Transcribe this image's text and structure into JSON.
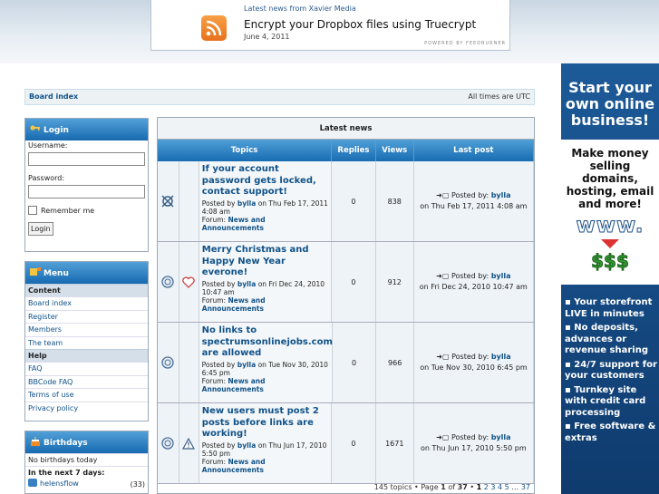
{
  "feed": {
    "source": "Latest news from Xavier Media",
    "headline": "Encrypt your Dropbox files using Truecrypt",
    "date": "June 4, 2011",
    "powered": "POWERED BY FEEDBURNER"
  },
  "breadcrumb": {
    "board_index": "Board index",
    "timezone": "All times are UTC"
  },
  "login": {
    "title": "Login",
    "username_label": "Username:",
    "password_label": "Password:",
    "remember_label": "Remember me",
    "button": "Login"
  },
  "menu": {
    "title": "Menu",
    "sections": [
      {
        "heading": "Content",
        "items": [
          "Board index",
          "Register",
          "Members",
          "The team"
        ]
      },
      {
        "heading": "Help",
        "items": [
          "FAQ",
          "BBCode FAQ",
          "Terms of use",
          "Privacy policy"
        ]
      }
    ]
  },
  "birthdays": {
    "title": "Birthdays",
    "today": "No birthdays today",
    "next_label": "In the next 7 days:",
    "user": "helensflow",
    "age": "(33)"
  },
  "news": {
    "title": "Latest news",
    "columns": {
      "topics": "Topics",
      "replies": "Replies",
      "views": "Views",
      "last_post": "Last post"
    },
    "rows": [
      {
        "title": "If your account password gets locked, contact support!",
        "posted_prefix": "Posted by",
        "author": "bylla",
        "posted_on": "on Thu Feb 17, 2011 4:08 am",
        "forum_prefix": "Forum:",
        "forum": "News and Announcements",
        "replies": "0",
        "views": "838",
        "last_prefix": "Posted by:",
        "last_author": "bylla",
        "last_date": "on Thu Feb 17, 2011 4:08 am",
        "icon": "global-announcement-icon",
        "icon2": ""
      },
      {
        "title": "Merry Christmas and Happy New Year everone!",
        "posted_prefix": "Posted by",
        "author": "bylla",
        "posted_on": "on Fri Dec 24, 2010 10:47 am",
        "forum_prefix": "Forum:",
        "forum": "News and Announcements",
        "replies": "0",
        "views": "912",
        "last_prefix": "Posted by:",
        "last_author": "bylla",
        "last_date": "on Fri Dec 24, 2010 10:47 am",
        "icon": "topic-read-icon",
        "icon2": "heart-icon"
      },
      {
        "title": "No links to spectrumsonlinejobs.com are allowed",
        "posted_prefix": "Posted by",
        "author": "bylla",
        "posted_on": "on Tue Nov 30, 2010 6:45 pm",
        "forum_prefix": "Forum:",
        "forum": "News and Announcements",
        "replies": "0",
        "views": "966",
        "last_prefix": "Posted by:",
        "last_author": "bylla",
        "last_date": "on Tue Nov 30, 2010 6:45 pm",
        "icon": "topic-read-icon",
        "icon2": ""
      },
      {
        "title": "New users must post 2 posts before links are working!",
        "posted_prefix": "Posted by",
        "author": "bylla",
        "posted_on": "on Thu Jun 17, 2010 5:50 pm",
        "forum_prefix": "Forum:",
        "forum": "News and Announcements",
        "replies": "0",
        "views": "1671",
        "last_prefix": "Posted by:",
        "last_author": "bylla",
        "last_date": "on Thu Jun 17, 2010 5:50 pm",
        "icon": "topic-read-icon",
        "icon2": "warning-icon"
      }
    ],
    "pagination": {
      "summary": "145 topics • Page",
      "current": "1",
      "of": "of",
      "total": "37",
      "sep": "•",
      "pages": [
        "1",
        "2",
        "3",
        "4",
        "5",
        "…",
        "37"
      ]
    }
  },
  "ad": {
    "headline": "Start your own online business!",
    "sub": "Make money selling domains, hosting, email and more!",
    "www": "www.",
    "features": [
      "Your storefront LIVE in minutes",
      "No deposits, advances or revenue sharing",
      "24/7 support for your customers",
      "Turnkey site with credit card processing",
      "Free software & extras"
    ]
  },
  "colors": {
    "header_blue": "#186cb2",
    "link": "#105289",
    "rss_orange": "#e8711c",
    "ad_blue": "#1c5a98"
  }
}
